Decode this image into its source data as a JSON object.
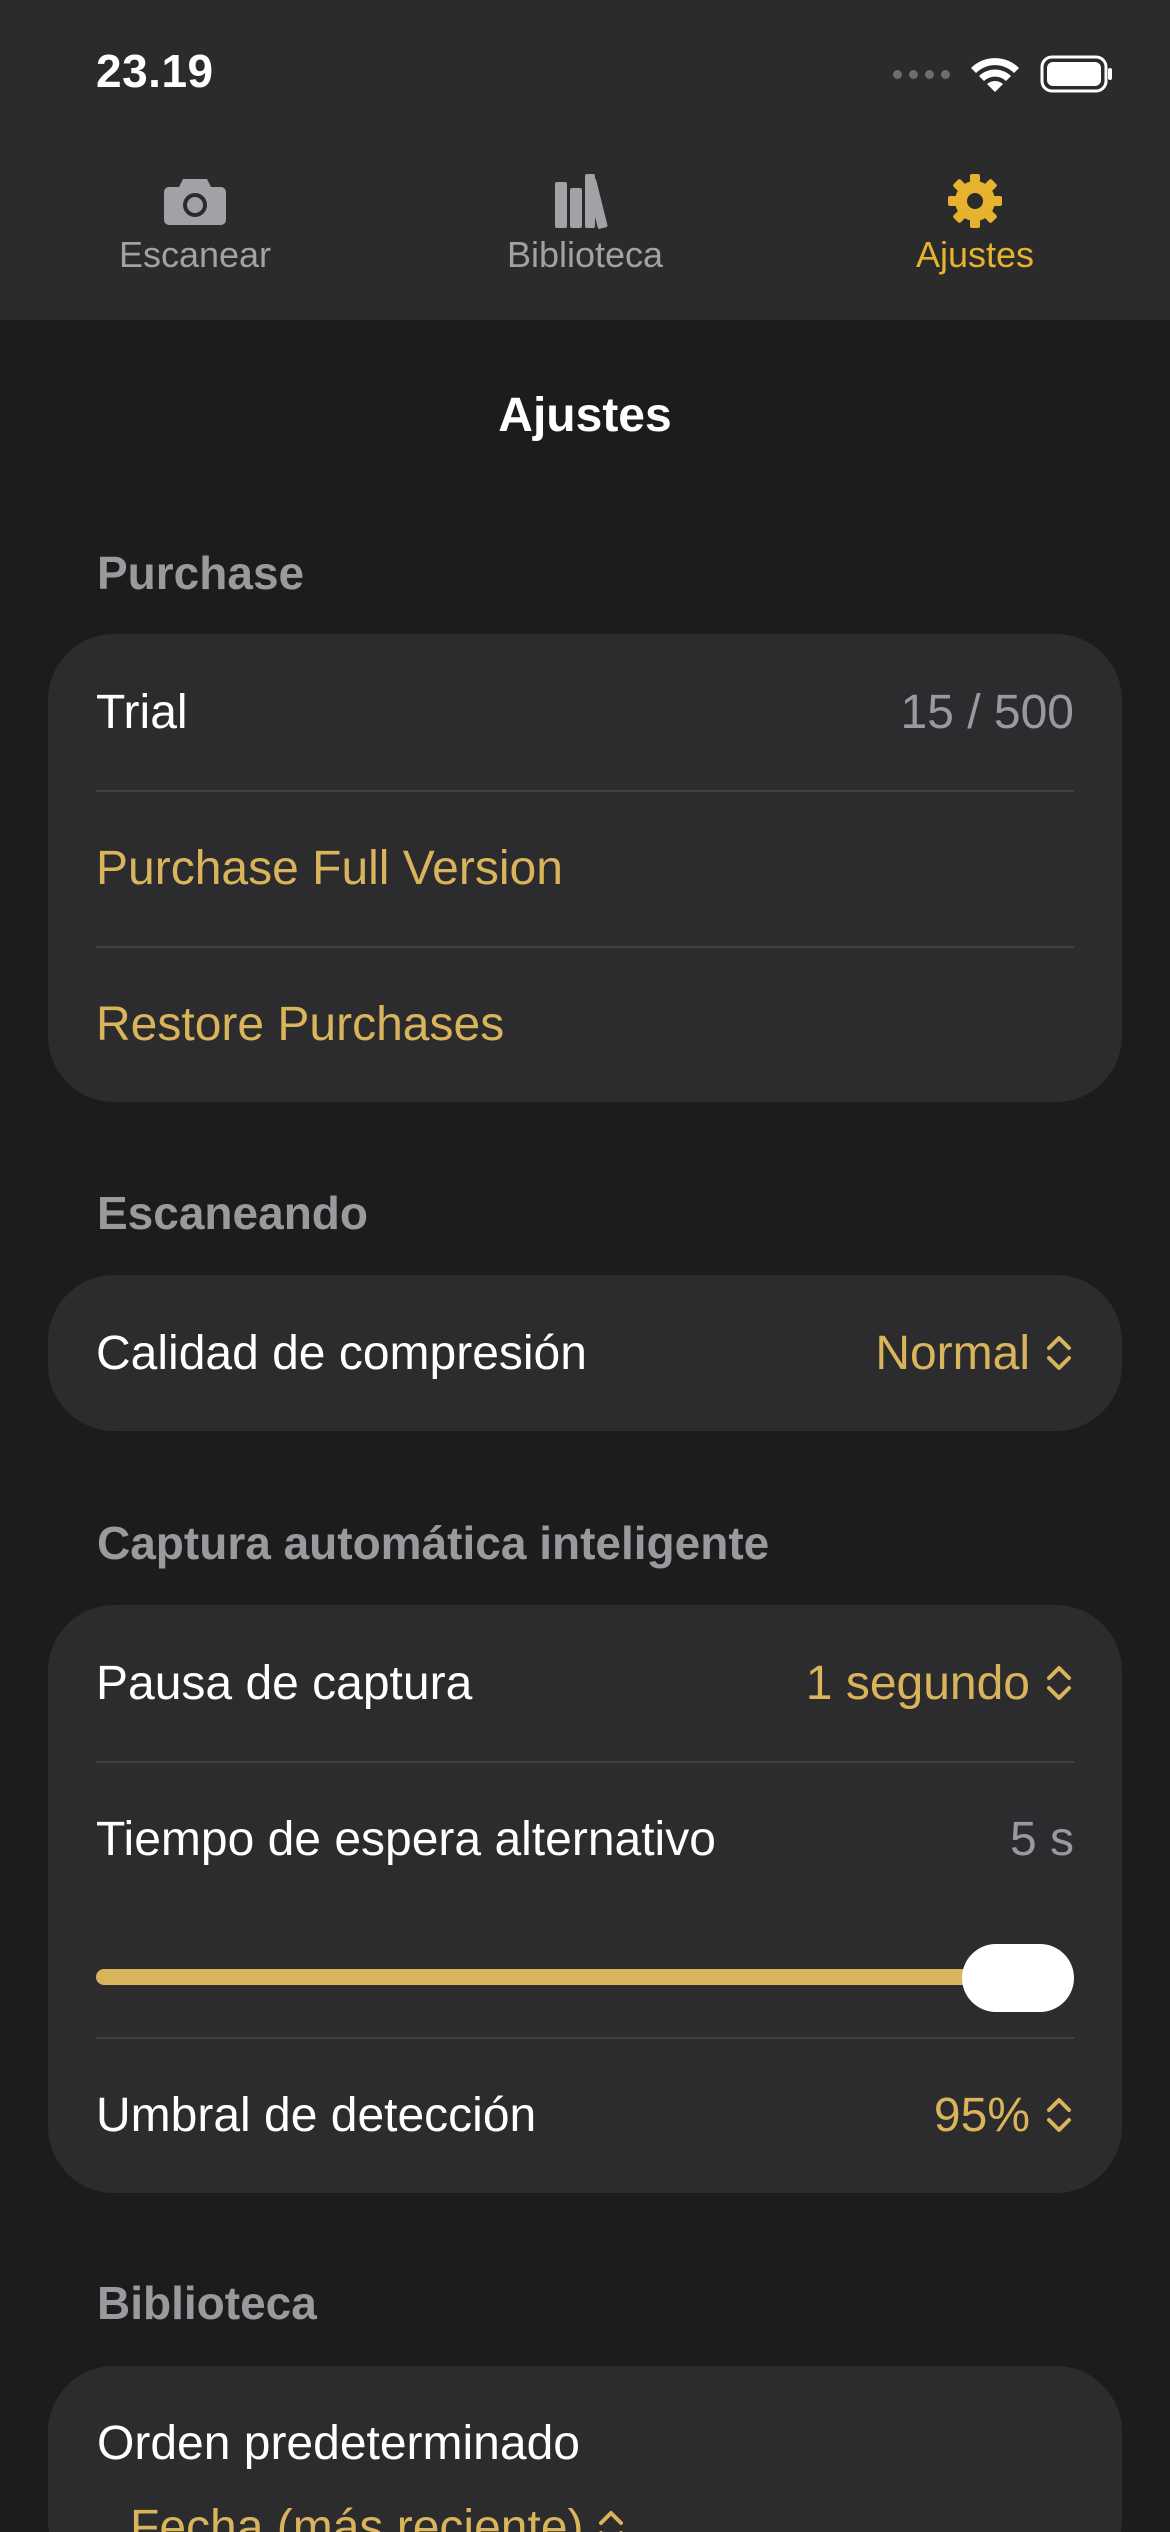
{
  "status": {
    "time": "23.19"
  },
  "tabs": [
    {
      "label": "Escanear",
      "icon": "camera-icon"
    },
    {
      "label": "Biblioteca",
      "icon": "books-icon"
    },
    {
      "label": "Ajustes",
      "icon": "gear-icon"
    }
  ],
  "active_tab": "Ajustes",
  "page_title": "Ajustes",
  "purchase": {
    "title": "Purchase",
    "trial_label": "Trial",
    "trial_value": "15 / 500",
    "purchase_full": "Purchase Full Version",
    "restore": "Restore Purchases"
  },
  "scanning": {
    "title": "Escaneando",
    "quality_label": "Calidad de compresión",
    "quality_value": "Normal"
  },
  "auto_capture": {
    "title": "Captura automática inteligente",
    "pause_label": "Pausa de captura",
    "pause_value": "1 segundo",
    "timeout_label": "Tiempo de espera alternativo",
    "timeout_value": "5 s",
    "timeout_slider_level": 1.0,
    "threshold_label": "Umbral de detección",
    "threshold_value": "95%"
  },
  "library": {
    "title": "Biblioteca",
    "order_label": "Orden predeterminado",
    "order_value": "Fecha (más reciente)"
  },
  "colors": {
    "accent": "#e7b22e",
    "accent_text": "#d9b45a",
    "background": "#1c1c1d",
    "card": "#2c2c2e"
  }
}
